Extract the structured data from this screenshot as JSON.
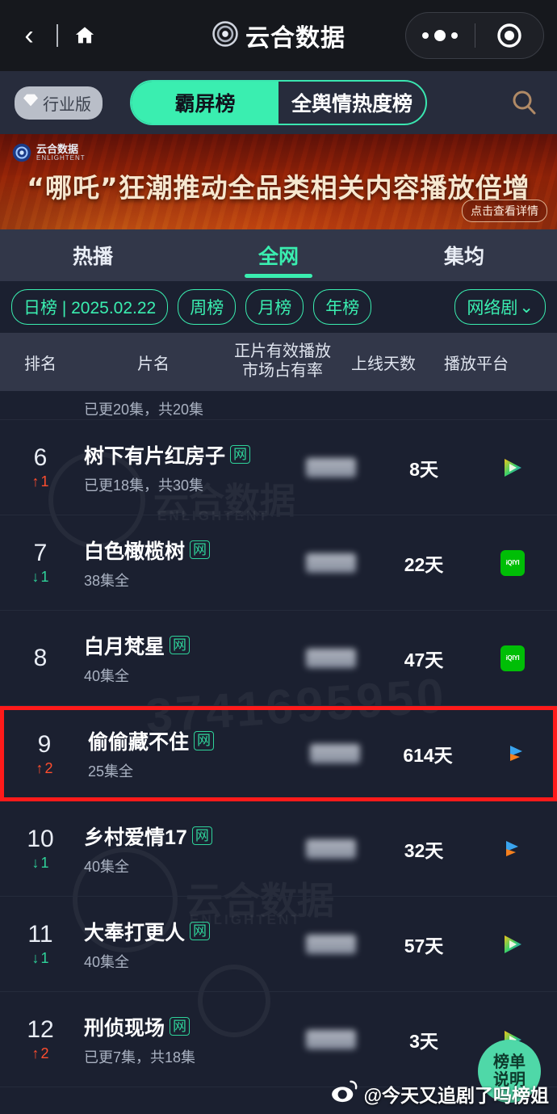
{
  "navbar": {
    "back_icon": "chevron-left-icon",
    "home_icon": "home-icon",
    "title": "云合数据",
    "logo_icon": "yunhe-logo-icon",
    "capsule_more_icon": "more-dots-icon",
    "capsule_target_icon": "target-circle-icon"
  },
  "toolbar": {
    "industry_badge": "行业版",
    "diamond_icon": "diamond-icon",
    "segment_left": "霸屏榜",
    "segment_right": "全舆情热度榜",
    "search_icon": "search-icon"
  },
  "banner": {
    "logo_text": "云合数据",
    "logo_sub": "ENLIGHTENT",
    "title": "“哪吒”狂潮推动全品类相关内容播放倍增",
    "cta": "点击查看详情"
  },
  "main_tabs": [
    {
      "label": "热播",
      "active": false
    },
    {
      "label": "全网",
      "active": true
    },
    {
      "label": "集均",
      "active": false
    }
  ],
  "filters": {
    "chips": [
      {
        "label": "日榜 | 2025.02.22",
        "active": true
      },
      {
        "label": "周榜",
        "active": false
      },
      {
        "label": "月榜",
        "active": false
      },
      {
        "label": "年榜",
        "active": false
      }
    ],
    "dropdown": {
      "label": "网络剧",
      "icon": "chevron-down-icon"
    }
  },
  "table": {
    "headers": {
      "rank": "排名",
      "name": "片名",
      "share_line1": "正片有效播放",
      "share_line2": "市场占有率",
      "days": "上线天数",
      "platform": "播放平台"
    },
    "cut_row_text": "已更20集，共20集",
    "rows": [
      {
        "rank": "6",
        "delta": "1",
        "delta_dir": "up",
        "title": "树下有片红房子",
        "badge": "网",
        "subtitle": "已更18集，共30集",
        "share": "",
        "days": "8天",
        "platform": "youku",
        "highlight": false
      },
      {
        "rank": "7",
        "delta": "1",
        "delta_dir": "down",
        "title": "白色橄榄树",
        "badge": "网",
        "subtitle": "38集全",
        "share": "",
        "days": "22天",
        "platform": "iqiyi",
        "highlight": false
      },
      {
        "rank": "8",
        "delta": "",
        "delta_dir": "none",
        "title": "白月梵星",
        "badge": "网",
        "subtitle": "40集全",
        "share": "",
        "days": "47天",
        "platform": "iqiyi",
        "highlight": false
      },
      {
        "rank": "9",
        "delta": "2",
        "delta_dir": "up",
        "title": "偷偷藏不住",
        "badge": "网",
        "subtitle": "25集全",
        "share": "",
        "days": "614天",
        "platform": "tencent",
        "highlight": true
      },
      {
        "rank": "10",
        "delta": "1",
        "delta_dir": "down",
        "title": "乡村爱情17",
        "badge": "网",
        "subtitle": "40集全",
        "share": "",
        "days": "32天",
        "platform": "tencent",
        "highlight": false
      },
      {
        "rank": "11",
        "delta": "1",
        "delta_dir": "down",
        "title": "大奉打更人",
        "badge": "网",
        "subtitle": "40集全",
        "share": "",
        "days": "57天",
        "platform": "youku",
        "highlight": false
      },
      {
        "rank": "12",
        "delta": "2",
        "delta_dir": "up",
        "title": "刑侦现场",
        "badge": "网",
        "subtitle": "已更7集，共18集",
        "share": "",
        "days": "3天",
        "platform": "youku",
        "highlight": false
      }
    ]
  },
  "fab": {
    "line1": "榜单",
    "line2": "说明"
  },
  "watermark": {
    "brand": "云合数据",
    "brand_sub": "ENLIGHTENT",
    "number": "3741695950",
    "weibo_handle": "@今天又追剧了吗榜姐",
    "weibo_icon": "weibo-icon"
  },
  "colors": {
    "accent": "#3aeeb0",
    "up": "#ff4d2e",
    "down": "#2fd39a",
    "highlight": "#ff1a1a",
    "page_bg": "#1b2030"
  }
}
